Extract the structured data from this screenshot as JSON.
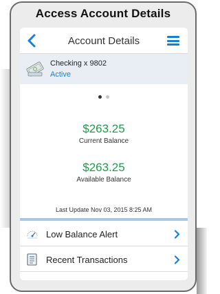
{
  "banner": {
    "title": "Access Account Details"
  },
  "nav": {
    "title": "Account Details",
    "back_icon": "chevron-left-icon",
    "menu_icon": "hamburger-menu-icon"
  },
  "account": {
    "name": "Checking x 9802",
    "status": "Active",
    "icon": "cash-icon"
  },
  "pager": {
    "pages": 2,
    "current": 1
  },
  "balances": {
    "current_amount": "$263.25",
    "current_label": "Current Balance",
    "available_amount": "$263.25",
    "available_label": "Available Balance"
  },
  "last_update": "Last Update Nov 03, 2015 8:25 AM",
  "menu_items": [
    {
      "label": "Low Balance Alert",
      "icon": "gauge-icon"
    },
    {
      "label": "Recent Transactions",
      "icon": "document-list-icon"
    }
  ],
  "colors": {
    "accent": "#1a7fcf",
    "amount": "#1e9c4a",
    "account_bg": "#e8eef4"
  }
}
